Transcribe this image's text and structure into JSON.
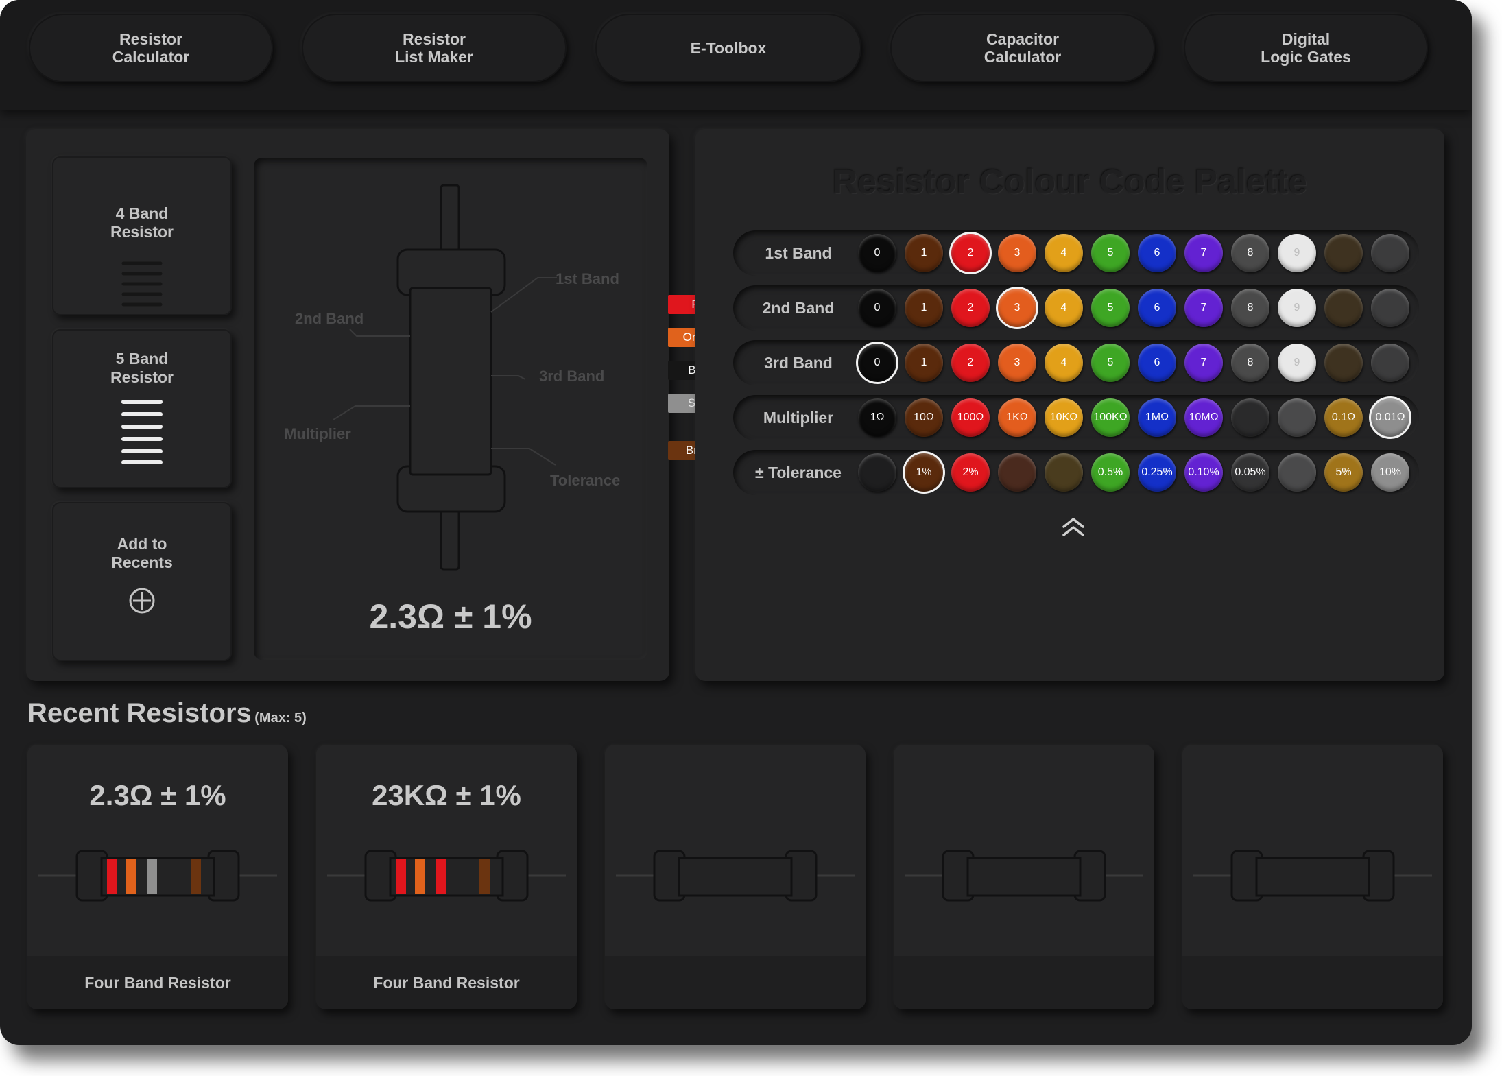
{
  "nav": [
    {
      "label": "Resistor\nCalculator",
      "name": "nav-resistor-calculator"
    },
    {
      "label": "Resistor\nList Maker",
      "name": "nav-resistor-list-maker"
    },
    {
      "label": "E-Toolbox",
      "name": "nav-e-toolbox"
    },
    {
      "label": "Capacitor\nCalculator",
      "name": "nav-capacitor-calculator"
    },
    {
      "label": "Digital\nLogic Gates",
      "name": "nav-digital-logic-gates"
    }
  ],
  "sidebar": {
    "four_band": "4 Band\nResistor",
    "five_band": "5 Band\nResistor",
    "add_recents": "Add to\nRecents"
  },
  "diagram": {
    "callouts": {
      "first": "1st Band",
      "second": "2nd Band",
      "third": "3rd Band",
      "multiplier": "Multiplier",
      "tolerance": "Tolerance"
    },
    "bands": [
      {
        "label": "Red",
        "color": "#e0161d",
        "text": "#ffffff"
      },
      {
        "label": "Orange",
        "color": "#e0621c",
        "text": "#ffffff"
      },
      {
        "label": "Black",
        "color": "#161616",
        "text": "#ffffff"
      },
      {
        "label": "Silver",
        "color": "#8f8f8f",
        "text": "#e8e8e8"
      },
      {
        "label": "Brown",
        "color": "#6b3410",
        "text": "#ffffff"
      }
    ],
    "result": "2.3Ω ± 1%"
  },
  "palette": {
    "title": "Resistor Colour Code Palette",
    "rows": [
      {
        "label": "1st Band",
        "selected": 2,
        "cells": [
          {
            "t": "0",
            "c": "#0b0b0b"
          },
          {
            "t": "1",
            "c": "#5a2a0c"
          },
          {
            "t": "2",
            "c": "#e0161d"
          },
          {
            "t": "3",
            "c": "#e35d1e"
          },
          {
            "t": "4",
            "c": "#e2a019"
          },
          {
            "t": "5",
            "c": "#3ea624"
          },
          {
            "t": "6",
            "c": "#1430c8"
          },
          {
            "t": "7",
            "c": "#6322d2"
          },
          {
            "t": "8",
            "c": "#4a4a4a"
          },
          {
            "t": "9",
            "c": "#e8e8e8"
          },
          {
            "t": "",
            "c": "#3e3220"
          },
          {
            "t": "",
            "c": "#3c3c3d"
          }
        ]
      },
      {
        "label": "2nd Band",
        "selected": 3,
        "cells": [
          {
            "t": "0",
            "c": "#0b0b0b"
          },
          {
            "t": "1",
            "c": "#5a2a0c"
          },
          {
            "t": "2",
            "c": "#e0161d"
          },
          {
            "t": "3",
            "c": "#e35d1e"
          },
          {
            "t": "4",
            "c": "#e2a019"
          },
          {
            "t": "5",
            "c": "#3ea624"
          },
          {
            "t": "6",
            "c": "#1430c8"
          },
          {
            "t": "7",
            "c": "#6322d2"
          },
          {
            "t": "8",
            "c": "#4a4a4a"
          },
          {
            "t": "9",
            "c": "#e8e8e8"
          },
          {
            "t": "",
            "c": "#3e3220"
          },
          {
            "t": "",
            "c": "#3c3c3d"
          }
        ]
      },
      {
        "label": "3rd Band",
        "selected": 0,
        "cells": [
          {
            "t": "0",
            "c": "#0b0b0b"
          },
          {
            "t": "1",
            "c": "#5a2a0c"
          },
          {
            "t": "2",
            "c": "#e0161d"
          },
          {
            "t": "3",
            "c": "#e35d1e"
          },
          {
            "t": "4",
            "c": "#e2a019"
          },
          {
            "t": "5",
            "c": "#3ea624"
          },
          {
            "t": "6",
            "c": "#1430c8"
          },
          {
            "t": "7",
            "c": "#6322d2"
          },
          {
            "t": "8",
            "c": "#4a4a4a"
          },
          {
            "t": "9",
            "c": "#e8e8e8"
          },
          {
            "t": "",
            "c": "#3e3220"
          },
          {
            "t": "",
            "c": "#3c3c3d"
          }
        ]
      },
      {
        "label": "Multiplier",
        "selected": 11,
        "cells": [
          {
            "t": "1Ω",
            "c": "#0b0b0b"
          },
          {
            "t": "10Ω",
            "c": "#5a2a0c"
          },
          {
            "t": "100Ω",
            "c": "#e0161d"
          },
          {
            "t": "1KΩ",
            "c": "#e35d1e"
          },
          {
            "t": "10KΩ",
            "c": "#e2a019"
          },
          {
            "t": "100KΩ",
            "c": "#3ea624"
          },
          {
            "t": "1MΩ",
            "c": "#1430c8"
          },
          {
            "t": "10MΩ",
            "c": "#6322d2"
          },
          {
            "t": "",
            "c": "#2a2a2b"
          },
          {
            "t": "",
            "c": "#4a4a4b"
          },
          {
            "t": "0.1Ω",
            "c": "#a0741a"
          },
          {
            "t": "0.01Ω",
            "c": "#8e8e8e"
          }
        ]
      },
      {
        "label": "± Tolerance",
        "selected": 1,
        "cells": [
          {
            "t": "",
            "c": "#1e1e1f"
          },
          {
            "t": "1%",
            "c": "#5a2a0c"
          },
          {
            "t": "2%",
            "c": "#e0161d"
          },
          {
            "t": "",
            "c": "#4a2a1e"
          },
          {
            "t": "",
            "c": "#4a3c1e"
          },
          {
            "t": "0.5%",
            "c": "#3ea624"
          },
          {
            "t": "0.25%",
            "c": "#1430c8"
          },
          {
            "t": "0.10%",
            "c": "#6322d2"
          },
          {
            "t": "0.05%",
            "c": "#333334"
          },
          {
            "t": "",
            "c": "#4a4a4b"
          },
          {
            "t": "5%",
            "c": "#a0741a"
          },
          {
            "t": "10%",
            "c": "#8e8e8e"
          }
        ]
      }
    ],
    "collapse_icon": "double-chevron-up"
  },
  "recents": {
    "title": "Recent Resistors",
    "max_label": "(Max: 5)",
    "cards": [
      {
        "value": "2.3Ω ± 1%",
        "type": "Four Band Resistor",
        "bands": [
          "#e0161d",
          "#e0621c",
          "#8f8f8f",
          "#6b3410"
        ]
      },
      {
        "value": "23KΩ ± 1%",
        "type": "Four Band Resistor",
        "bands": [
          "#e0161d",
          "#e0621c",
          "#e0161d",
          "#6b3410"
        ]
      },
      {
        "value": "",
        "type": "",
        "bands": []
      },
      {
        "value": "",
        "type": "",
        "bands": []
      },
      {
        "value": "",
        "type": "",
        "bands": []
      }
    ]
  }
}
